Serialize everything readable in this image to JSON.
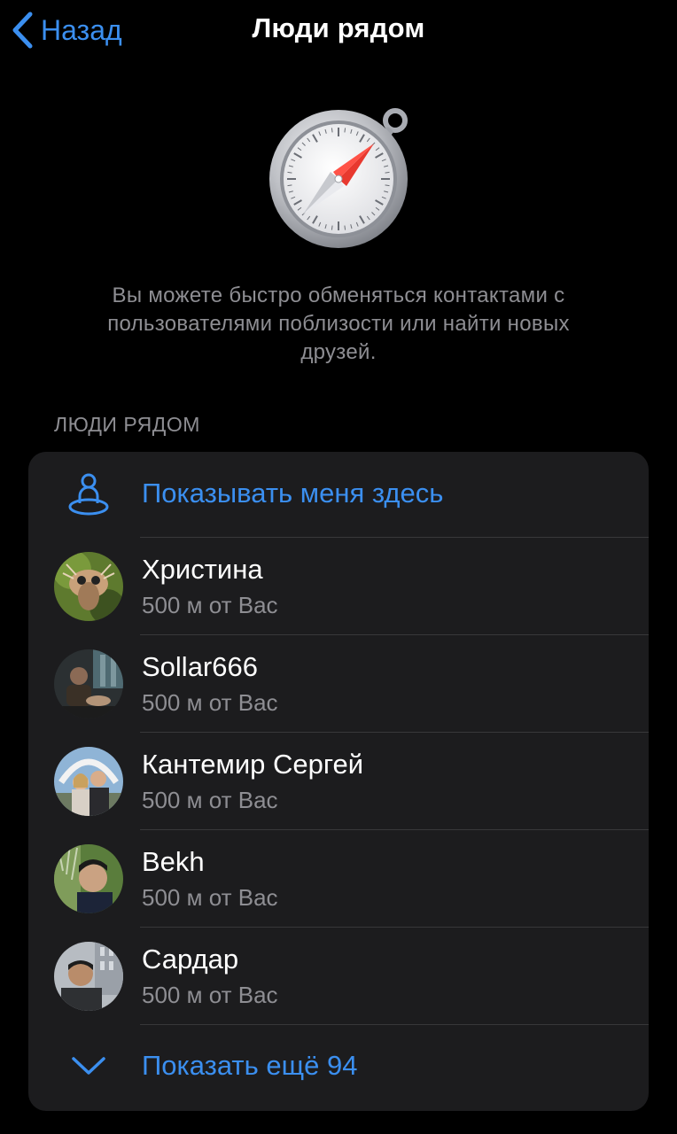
{
  "nav": {
    "back_label": "Назад",
    "title": "Люди рядом"
  },
  "intro": {
    "icon": "compass-icon",
    "description": "Вы можете быстро обменяться контактами с пользователями поблизости или найти новых друзей."
  },
  "section": {
    "header": "ЛЮДИ РЯДОМ",
    "show_me_label": "Показывать меня здесь",
    "show_me_icon": "person-location-icon",
    "people": [
      {
        "name": "Христина",
        "distance": "500 м от Вас"
      },
      {
        "name": "Sollar666",
        "distance": "500 м от Вас"
      },
      {
        "name": "Кантемир Сергей",
        "distance": "500 м от Вас"
      },
      {
        "name": "Bekh",
        "distance": "500 м от Вас"
      },
      {
        "name": "Сардар",
        "distance": "500 м от Вас"
      }
    ],
    "show_more_label": "Показать ещё 94",
    "show_more_icon": "chevron-down-icon"
  },
  "colors": {
    "background": "#000000",
    "card": "#1c1c1e",
    "accent": "#3b8ff0",
    "secondary_text": "#8e8e93",
    "divider": "#38383a"
  }
}
